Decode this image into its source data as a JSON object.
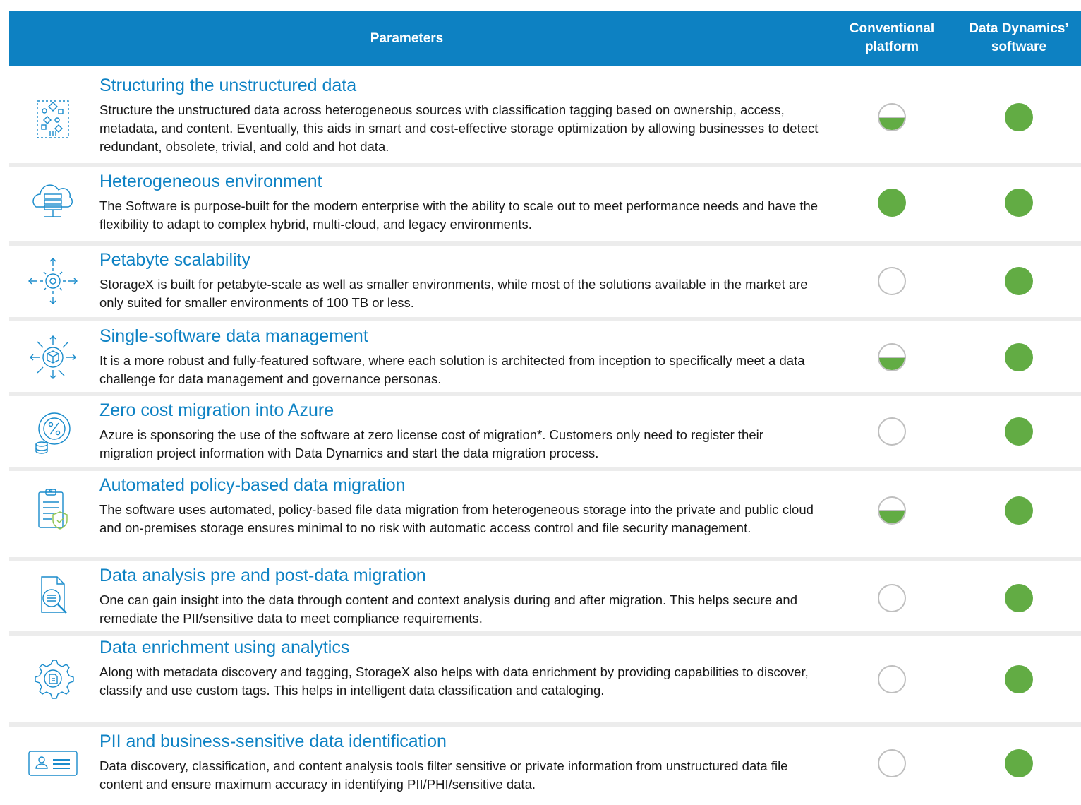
{
  "header": {
    "parameters": "Parameters",
    "conventional": "Conventional platform",
    "data_dynamics": "Data Dynamics’ software"
  },
  "colors": {
    "header_bg": "#0d81c2",
    "title": "#0e82c4",
    "full": "#62ac44",
    "outline": "#bfbfbf"
  },
  "rows": [
    {
      "icon": "data-structure-icon",
      "title": "Structuring the unstructured data",
      "description": "Structure the unstructured data across heterogeneous sources with classification tagging based on ownership, access, metadata, and content. Eventually, this aids in smart and cost-effective storage optimization by allowing businesses to detect redundant, obsolete, trivial, and cold and hot data.",
      "conventional": "half",
      "data_dynamics": "full"
    },
    {
      "icon": "cloud-server-icon",
      "title": "Heterogeneous environment",
      "description": "The Software is purpose-built for the modern enterprise with the ability to scale out to meet performance needs and have the flexibility to adapt to complex hybrid, multi-cloud, and legacy environments.",
      "conventional": "full",
      "data_dynamics": "full"
    },
    {
      "icon": "gear-scale-icon",
      "title": "Petabyte scalability",
      "description": "StorageX is built for petabyte-scale as well as smaller environments, while most of the solutions available in the market are only suited for smaller environments of 100 TB or less.",
      "conventional": "empty",
      "data_dynamics": "full"
    },
    {
      "icon": "cube-network-icon",
      "title": "Single-software data management",
      "description": "It is a more robust and fully-featured software, where each solution is architected from inception to specifically meet a data challenge for data management and governance personas.",
      "conventional": "half",
      "data_dynamics": "full"
    },
    {
      "icon": "percent-coin-icon",
      "title": "Zero cost migration into Azure",
      "description": "Azure is sponsoring the use of the software at zero license cost of migration*. Customers only need to register their migration project information with Data Dynamics and start the data migration process.",
      "conventional": "empty",
      "data_dynamics": "full"
    },
    {
      "icon": "clipboard-shield-icon",
      "title": "Automated policy-based data migration",
      "description": "The software uses automated, policy-based file data migration from heterogeneous storage into the private and public cloud and on-premises storage ensures minimal to no risk with automatic access control and file security management.",
      "conventional": "half",
      "data_dynamics": "full"
    },
    {
      "icon": "document-search-icon",
      "title": "Data analysis pre and post-data migration",
      "description": "One can gain insight into the data through content and context analysis during and after migration. This helps secure and remediate the PII/sensitive data to meet compliance requirements.",
      "conventional": "empty",
      "data_dynamics": "full"
    },
    {
      "icon": "gear-document-icon",
      "title": "Data enrichment using analytics",
      "description": "Along with metadata discovery and tagging, StorageX also helps with data enrichment by providing capabilities to discover, classify and use custom tags. This helps in intelligent data classification and cataloging.",
      "conventional": "empty",
      "data_dynamics": "full"
    },
    {
      "icon": "id-card-icon",
      "title": "PII and business-sensitive data identification",
      "description": "Data discovery, classification, and content analysis tools filter sensitive or private information from unstructured data file content and ensure maximum accuracy in identifying PII/PHI/sensitive data.",
      "conventional": "empty",
      "data_dynamics": "full"
    }
  ]
}
